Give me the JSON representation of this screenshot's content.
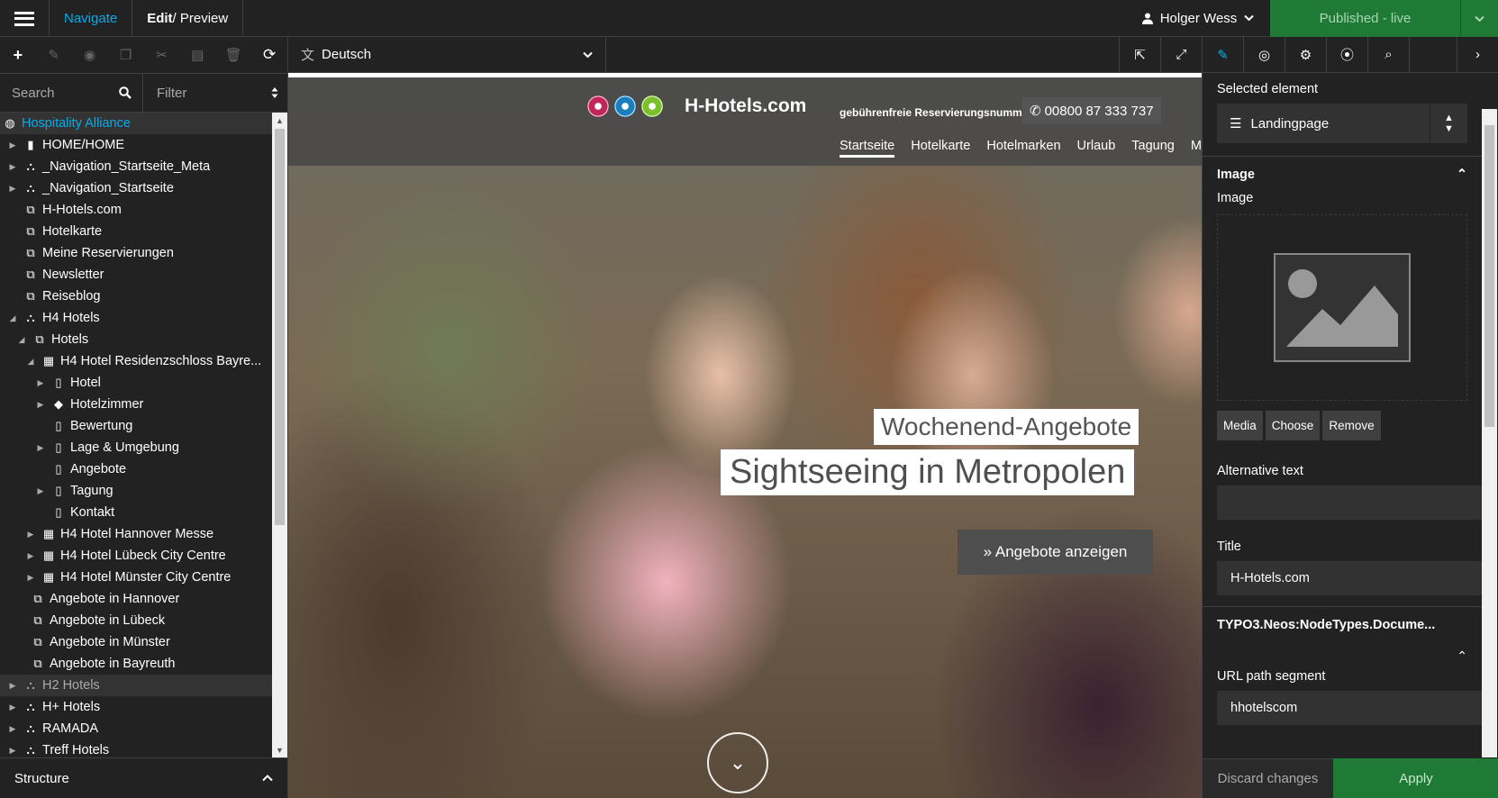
{
  "topbar": {
    "navigate": "Navigate",
    "edit": "Edit",
    "preview": " / Preview",
    "user": "Holger Wess",
    "published": "Published - live"
  },
  "left": {
    "search_placeholder": "Search",
    "filter_placeholder": "Filter",
    "structure": "Structure",
    "tree": [
      {
        "label": "Hospitality Alliance"
      },
      {
        "label": "HOME/HOME"
      },
      {
        "label": "_Navigation_Startseite_Meta"
      },
      {
        "label": "_Navigation_Startseite"
      },
      {
        "label": "H-Hotels.com"
      },
      {
        "label": "Hotelkarte"
      },
      {
        "label": "Meine Reservierungen"
      },
      {
        "label": "Newsletter"
      },
      {
        "label": "Reiseblog"
      },
      {
        "label": "H4 Hotels"
      },
      {
        "label": "Hotels"
      },
      {
        "label": "H4 Hotel Residenzschloss Bayre..."
      },
      {
        "label": "Hotel"
      },
      {
        "label": "Hotelzimmer"
      },
      {
        "label": "Bewertung"
      },
      {
        "label": "Lage & Umgebung"
      },
      {
        "label": "Angebote"
      },
      {
        "label": "Tagung"
      },
      {
        "label": "Kontakt"
      },
      {
        "label": "H4 Hotel Hannover Messe"
      },
      {
        "label": "H4 Hotel Lübeck City Centre"
      },
      {
        "label": "H4 Hotel Münster City Centre"
      },
      {
        "label": "Angebote in Hannover"
      },
      {
        "label": "Angebote in Lübeck"
      },
      {
        "label": "Angebote in Münster"
      },
      {
        "label": "Angebote in Bayreuth"
      },
      {
        "label": "H2 Hotels"
      },
      {
        "label": "H+ Hotels"
      },
      {
        "label": "RAMADA"
      },
      {
        "label": "Treff Hotels"
      }
    ]
  },
  "center": {
    "dimension": "Deutsch",
    "site": {
      "brand": "H-Hotels.com",
      "phone_label": "gebührenfreie Reservierungsnummer:",
      "phone": "00800 87 333 737",
      "nav": [
        "Startseite",
        "Hotelkarte",
        "Hotelmarken",
        "Urlaub",
        "Tagung",
        "Me"
      ],
      "headline_small": "Wochenend-Angebote",
      "headline_big": "Sightseeing in Metropolen",
      "cta": "» Angebote anzeigen"
    }
  },
  "right": {
    "selected_label": "Selected element",
    "selected_value": "Landingpage",
    "image_section": "Image",
    "image_label": "Image",
    "btn_media": "Media",
    "btn_choose": "Choose",
    "btn_remove": "Remove",
    "alt_label": "Alternative text",
    "alt_value": "",
    "title_label": "Title",
    "title_value": "H-Hotels.com",
    "nodetype_section": "TYPO3.Neos:NodeTypes.Docume...",
    "url_label": "URL path segment",
    "url_value": "hhotelscom",
    "discard": "Discard changes",
    "apply": "Apply"
  },
  "colors": {
    "accent": "#00adee",
    "publish_green": "#1f7a36"
  }
}
